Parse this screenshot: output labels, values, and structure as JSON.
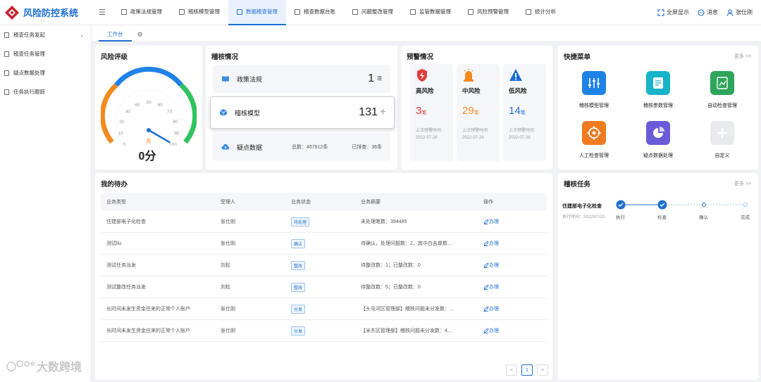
{
  "app": {
    "title": "风险防控系统"
  },
  "nav": [
    {
      "label": "政策法规管理"
    },
    {
      "label": "稽核模型管理"
    },
    {
      "label": "数据稽查管理",
      "active": true
    },
    {
      "label": "稽查数据台账"
    },
    {
      "label": "问题整改管理"
    },
    {
      "label": "监管数据管理"
    },
    {
      "label": "风险预警管理"
    },
    {
      "label": "统计分析"
    }
  ],
  "top_right": {
    "fullscreen": "全屏显示",
    "messages": "消息",
    "user": "张仕刚"
  },
  "sidebar": [
    {
      "label": "稽查任务发起"
    },
    {
      "label": "稽查任务管理"
    },
    {
      "label": "疑点数据处理"
    },
    {
      "label": "任务执行跟踪"
    }
  ],
  "tabs": {
    "workbench": "工作台"
  },
  "risk": {
    "title": "风险评级",
    "level_label": "高",
    "score": "0分",
    "ticks": [
      "0",
      "10",
      "20",
      "30",
      "40",
      "50",
      "60",
      "70",
      "80",
      "90",
      "100"
    ],
    "needle_value": 100
  },
  "audit": {
    "title": "稽核情况",
    "policy": {
      "label": "政策法规",
      "count": "1",
      "unit": "项"
    },
    "model": {
      "label": "稽核模型",
      "count": "131",
      "unit": "个"
    },
    "suspect": {
      "label": "疑点数据",
      "total": "总数：467912条",
      "checked": "已排查：36条"
    }
  },
  "warning": {
    "title": "预警情况",
    "items": [
      {
        "label": "高风险",
        "count": "3",
        "unit": "笔",
        "color": "#e23b3b",
        "t1": "上次预警时间",
        "t2": "2022-07-26"
      },
      {
        "label": "中风险",
        "count": "29",
        "unit": "笔",
        "color": "#f28a1e",
        "t1": "上次预警时间",
        "t2": "2022-07-26"
      },
      {
        "label": "低风险",
        "count": "14",
        "unit": "笔",
        "color": "#1f6fd1",
        "t1": "上次预警时间",
        "t2": "2022-07-26"
      }
    ]
  },
  "quick": {
    "title": "快捷菜单",
    "more": "更多 >>",
    "items": [
      {
        "label": "稽核模型管理",
        "color": "#1f82e6"
      },
      {
        "label": "稽核参数管理",
        "color": "#16b3c9"
      },
      {
        "label": "自动检查管理",
        "color": "#2ea55a"
      },
      {
        "label": "人工检查管理",
        "color": "#f07a1f"
      },
      {
        "label": "疑点数据处理",
        "color": "#6a5cd8"
      },
      {
        "label": "自定义",
        "color": "#e8eaee"
      }
    ]
  },
  "todo": {
    "title": "我的待办",
    "headers": [
      "业务类型",
      "受理人",
      "业务状态",
      "业务摘要",
      "操作"
    ],
    "rows": [
      {
        "type": "住建部电子化检查",
        "person": "张仕刚",
        "status": "待处理",
        "summary": "未处理笔数：394485",
        "action": "办理"
      },
      {
        "type": "测试llu",
        "person": "张仕刚",
        "status": "确认",
        "summary": "待确认，处理问题数：2，其中白名单数...",
        "action": "办理"
      },
      {
        "type": "测试任务派发",
        "person": "刘松",
        "status": "整改",
        "summary": "待整改数：1；已整改数：0",
        "action": "办理"
      },
      {
        "type": "测试整改任务派发",
        "person": "刘松",
        "status": "整改",
        "summary": "待整改数：5；已整改数：0",
        "action": "办理"
      },
      {
        "type": "长时间未发生资金往来的正常个人账户",
        "person": "张仕刚",
        "status": "分发",
        "summary": "【头屯河区管理部】稽核问题未分发数：...",
        "action": "办理"
      },
      {
        "type": "长时间未发生资金往来的正常个人账户",
        "person": "张仕刚",
        "status": "分发",
        "summary": "【米东区管理部】稽核问题未分发数：4,...",
        "action": "办理"
      }
    ],
    "pager": {
      "prev": "<",
      "current": "1",
      "next": ">"
    }
  },
  "task": {
    "title": "稽核任务",
    "more": "更多 >>",
    "name": "住建部电子化检查",
    "time": "执行时间：2022/07/23",
    "steps": [
      "执行",
      "检查",
      "确认",
      "完成"
    ]
  },
  "watermark": "大数跨境"
}
